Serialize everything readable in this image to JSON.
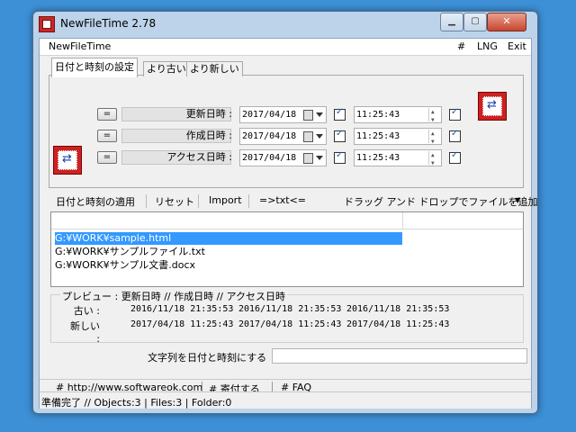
{
  "window": {
    "title": "NewFileTime 2.78"
  },
  "menu": {
    "app": "NewFileTime",
    "hash": "#",
    "lng": "LNG",
    "exit": "Exit"
  },
  "tabs": [
    "日付と時刻の設定",
    "より古い",
    "より新しい"
  ],
  "rows": [
    {
      "label": "更新日時 :",
      "date": "2017/04/18",
      "time": "11:25:43"
    },
    {
      "label": "作成日時 :",
      "date": "2017/04/18",
      "time": "11:25:43"
    },
    {
      "label": "アクセス日時 :",
      "date": "2017/04/18",
      "time": "11:25:43"
    }
  ],
  "eq_label": "=",
  "toolbar": {
    "apply": "日付と時刻の適用",
    "reset": "リセット",
    "import": "Import",
    "txt": "=>txt<=",
    "drag": "ドラッグ アンド ドロップでファイルを追加"
  },
  "files": [
    "G:¥WORK¥sample.html",
    "G:¥WORK¥サンプルファイル.txt",
    "G:¥WORK¥サンプル文書.docx"
  ],
  "preview": {
    "header": "プレビュー :    更新日時     //    作成日時     //    アクセス日時",
    "older_label": "古い :",
    "newer_label": "新しい :",
    "older": [
      "2016/11/18 21:35:53",
      "2016/11/18 21:35:53",
      "2016/11/18 21:35:53"
    ],
    "newer": [
      "2017/04/18 11:25:43",
      "2017/04/18 11:25:43",
      "2017/04/18 11:25:43"
    ]
  },
  "convert_label": "文字列を日付と時刻にする",
  "links": [
    "# http://www.softwareok.com",
    "# 寄付する",
    "# FAQ"
  ],
  "status": "準備完了 // Objects:3 | Files:3 | Folder:0"
}
